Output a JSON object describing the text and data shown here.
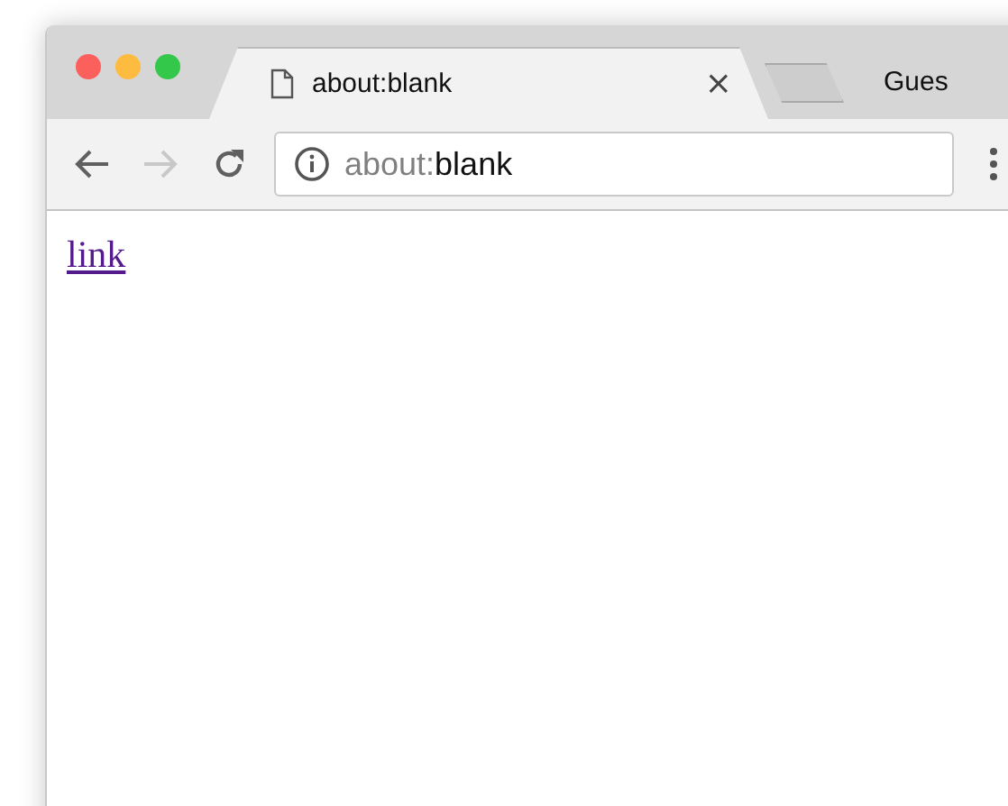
{
  "window": {
    "traffic_lights": [
      {
        "color": "#fc605c"
      },
      {
        "color": "#fdbc40"
      },
      {
        "color": "#34c84a"
      }
    ]
  },
  "tabs": [
    {
      "title": "about:blank",
      "selected": true,
      "close": "×"
    },
    {
      "selected": false,
      "kind": "new-tab"
    }
  ],
  "profile": {
    "label": "Gues"
  },
  "toolbar": {
    "back": {
      "disabled": false
    },
    "forward": {
      "disabled": true
    },
    "address": {
      "scheme": "about:",
      "path": "blank"
    }
  },
  "page": {
    "link": "link"
  }
}
